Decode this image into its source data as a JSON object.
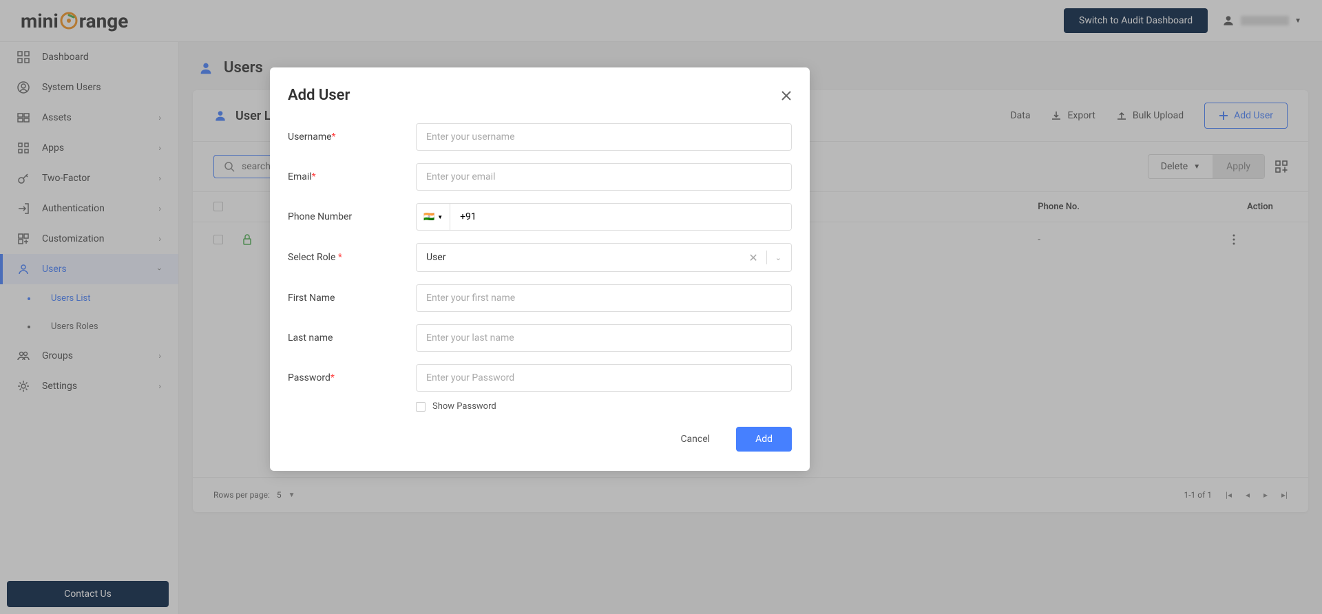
{
  "header": {
    "logo_prefix": "mini",
    "logo_suffix": "range",
    "audit_btn": "Switch to Audit Dashboard"
  },
  "sidebar": {
    "items": [
      {
        "label": "Dashboard"
      },
      {
        "label": "System Users"
      },
      {
        "label": "Assets"
      },
      {
        "label": "Apps"
      },
      {
        "label": "Two-Factor"
      },
      {
        "label": "Authentication"
      },
      {
        "label": "Customization"
      },
      {
        "label": "Users"
      },
      {
        "label": "Groups"
      },
      {
        "label": "Settings"
      }
    ],
    "sub_items": [
      {
        "label": "Users List"
      },
      {
        "label": "Users Roles"
      }
    ]
  },
  "page": {
    "title": "Users"
  },
  "card": {
    "title": "User List",
    "actions": {
      "data": "Data",
      "export": "Export",
      "bulk": "Bulk Upload",
      "add": "Add User"
    }
  },
  "toolbar": {
    "search_placeholder": "search",
    "delete": "Delete",
    "apply": "Apply"
  },
  "table": {
    "headers": {
      "phone": "Phone No.",
      "action": "Action"
    },
    "row": {
      "phone": "-"
    }
  },
  "pagination": {
    "rows_label": "Rows per page:",
    "rows_value": "5",
    "range": "1-1 of 1"
  },
  "contact": "Contact Us",
  "modal": {
    "title": "Add User",
    "labels": {
      "username": "Username",
      "email": "Email",
      "phone": "Phone Number",
      "role": "Select Role ",
      "first": "First Name",
      "last": "Last name",
      "password": "Password"
    },
    "placeholders": {
      "username": "Enter your username",
      "email": "Enter your email",
      "phone": "+91",
      "first": "Enter your first name",
      "last": "Enter your last name",
      "password": "Enter your Password"
    },
    "role_value": "User",
    "show_password": "Show Password",
    "cancel": "Cancel",
    "add": "Add"
  }
}
